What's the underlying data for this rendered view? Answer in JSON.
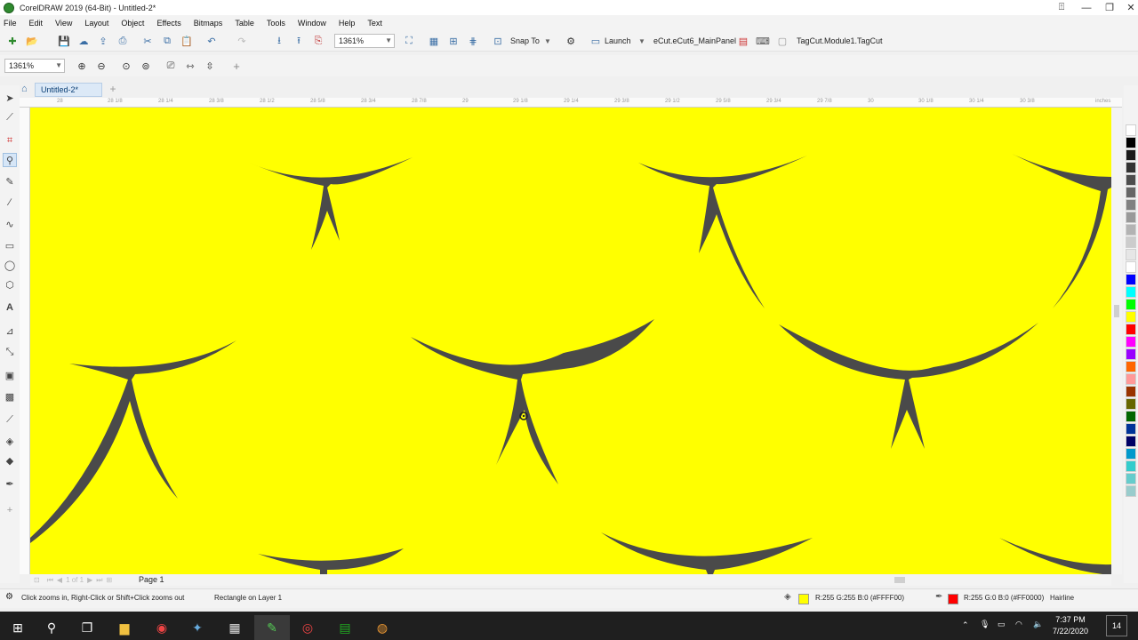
{
  "window": {
    "title": "CorelDRAW 2019 (64-Bit) - Untitled-2*"
  },
  "menu": [
    "File",
    "Edit",
    "View",
    "Layout",
    "Object",
    "Effects",
    "Bitmaps",
    "Table",
    "Tools",
    "Window",
    "Help",
    "Text"
  ],
  "toolbar": {
    "zoom_value": "1361%",
    "snap_to_label": "Snap To",
    "launch_label": "Launch",
    "panel_label": "eCut.eCut6_MainPanel",
    "module_label": "TagCut.Module1.TagCut"
  },
  "property_bar": {
    "zoom_value": "1361%"
  },
  "document": {
    "tab_label": "Untitled-2*"
  },
  "ruler": {
    "labels": [
      "28",
      "28 1/8",
      "28 1/4",
      "28 3/8",
      "28 1/2",
      "28 5/8",
      "28 3/4",
      "28 7/8",
      "29",
      "29 1/8",
      "29 1/4",
      "29 3/8",
      "29 1/2",
      "29 5/8",
      "29 3/4",
      "29 7/8",
      "30",
      "30 1/8",
      "30 1/4",
      "30 3/8"
    ],
    "unit": "inches"
  },
  "page_nav": {
    "page_label": "Page 1",
    "page_count": "1 of 1"
  },
  "status": {
    "hint": "Click zooms in, Right-Click or Shift+Click zooms out",
    "selection": "Rectangle on Layer 1",
    "fill_color": "#ffff00",
    "fill_text": "R:255 G:255 B:0 (#FFFF00)",
    "outline_color": "#ff0000",
    "outline_text": "R:255 G:0 B:0 (#FF0000)",
    "outline_width": "Hairline"
  },
  "colors": {
    "canvas": "#ffff00",
    "shape": "#4a4a4a",
    "taskbar": "#1f1f1f"
  },
  "palette": [
    "#ffffff",
    "#000000",
    "#1a1a1a",
    "#333333",
    "#4d4d4d",
    "#666666",
    "#808080",
    "#999999",
    "#b3b3b3",
    "#cccccc",
    "#e6e6e6",
    "#ffffff",
    "#0000ff",
    "#00ffff",
    "#00ff00",
    "#ffff00",
    "#ff0000",
    "#ff00ff",
    "#9900ff",
    "#ff6600",
    "#ff9999",
    "#993300",
    "#666600",
    "#006600",
    "#003399",
    "#000066",
    "#0099cc",
    "#33cccc",
    "#66cccc",
    "#99cccc"
  ],
  "taskbar": {
    "time": "7:37 PM",
    "date": "7/22/2020",
    "notification_count": "14"
  }
}
